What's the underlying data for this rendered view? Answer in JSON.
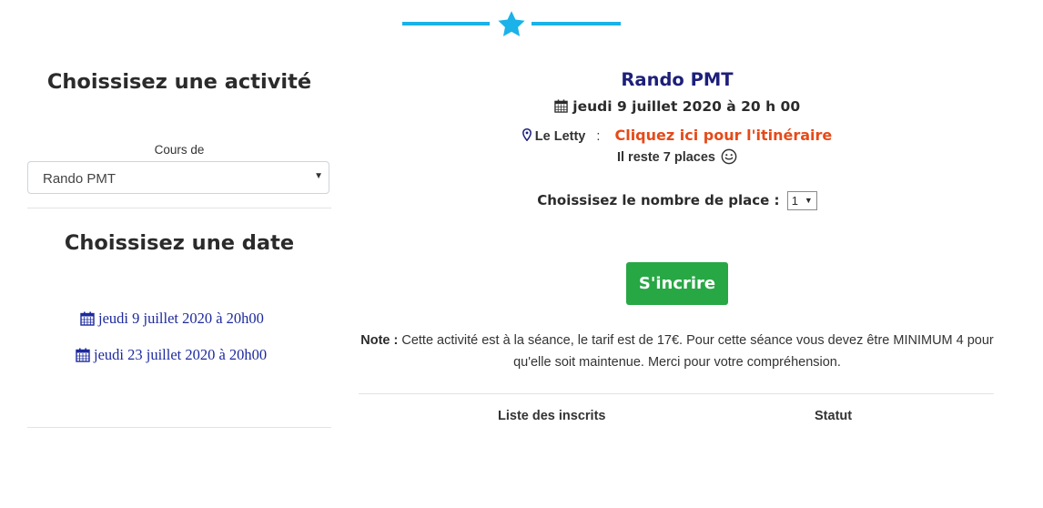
{
  "colors": {
    "accent": "#1ab2e8",
    "title_navy": "#1d1f7a",
    "link_blue": "#1d2a9e",
    "itinerary_orange": "#e64a19",
    "button_green": "#28a745"
  },
  "left": {
    "activity_heading": "Choissisez une activité",
    "select_label": "Cours de",
    "select_value": "Rando PMT",
    "date_heading": "Choissisez une date",
    "dates": [
      "jeudi 9 juillet 2020 à 20h00",
      "jeudi 23 juillet 2020 à 20h00"
    ]
  },
  "activity": {
    "title": "Rando PMT",
    "datetime": "jeudi 9 juillet 2020 à 20 h 00",
    "location": "Le Letty",
    "separator": ":",
    "itinerary_link": "Cliquez ici pour l'itinéraire",
    "places_left": "Il reste 7 places",
    "choose_label": "Choissisez le nombre de place :",
    "places_select_value": "1",
    "register_button": "S'incrire",
    "note_label": "Note :",
    "note_text": " Cette activité est à la séance, le tarif est de 17€. Pour cette séance vous devez être MINIMUM 4 pour qu'elle soit maintenue. Merci pour votre compréhension."
  },
  "table": {
    "headers": [
      "Liste des inscrits",
      "Statut"
    ]
  }
}
